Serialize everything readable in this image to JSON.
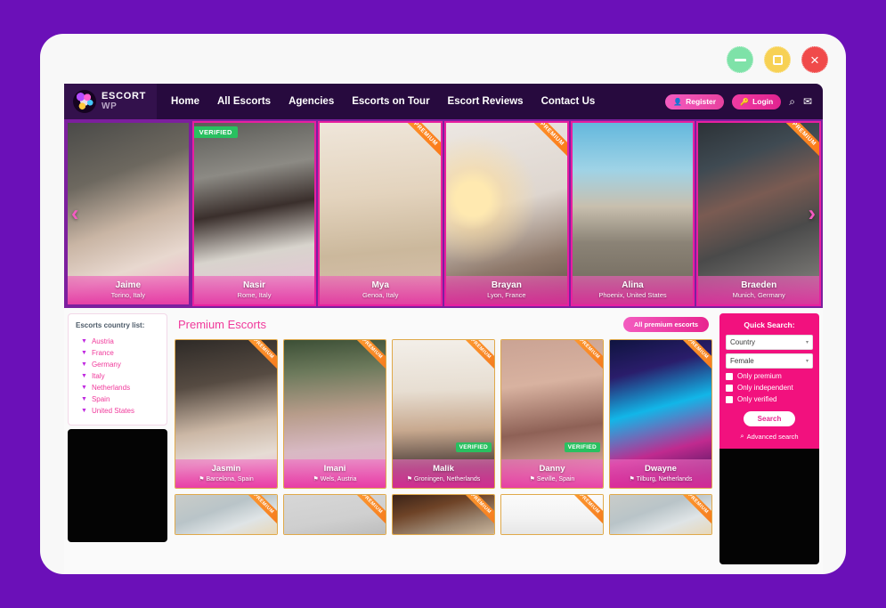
{
  "window": {
    "controls": [
      {
        "name": "minimize",
        "glyph": "minus"
      },
      {
        "name": "maximize",
        "glyph": "square"
      },
      {
        "name": "close",
        "glyph": "×"
      }
    ]
  },
  "navbar": {
    "logo": {
      "line1": "ESCORT",
      "line2": "WP"
    },
    "links": [
      "Home",
      "All Escorts",
      "Agencies",
      "Escorts on Tour",
      "Escort Reviews",
      "Contact Us"
    ],
    "register_label": "Register",
    "register_icon": "user-icon",
    "login_label": "Login",
    "login_icon": "key-icon",
    "search_icon": "⌕",
    "mail_icon": "✉"
  },
  "carousel": {
    "prev_icon": "‹",
    "next_icon": "›",
    "slides": [
      {
        "name": "Jaime",
        "location": "Torino, Italy",
        "badge": "",
        "ribbon": ""
      },
      {
        "name": "Nasir",
        "location": "Rome, Italy",
        "badge": "VERIFIED",
        "ribbon": ""
      },
      {
        "name": "Mya",
        "location": "Genoa, Italy",
        "badge": "",
        "ribbon": "PREMIUM"
      },
      {
        "name": "Brayan",
        "location": "Lyon, France",
        "badge": "",
        "ribbon": "PREMIUM"
      },
      {
        "name": "Alina",
        "location": "Phoenix, United States",
        "badge": "",
        "ribbon": ""
      },
      {
        "name": "Braeden",
        "location": "Munich, Germany",
        "badge": "",
        "ribbon": "PREMIUM"
      }
    ]
  },
  "left_sidebar": {
    "title": "Escorts country list:",
    "countries": [
      "Austria",
      "France",
      "Germany",
      "Italy",
      "Netherlands",
      "Spain",
      "United States"
    ]
  },
  "main": {
    "section_title": "Premium Escorts",
    "all_premium_label": "All premium escorts",
    "cards_row1": [
      {
        "name": "Jasmin",
        "location": "Barcelona, Spain",
        "ribbon": "PREMIUM",
        "verified": ""
      },
      {
        "name": "Imani",
        "location": "Wels, Austria",
        "ribbon": "PREMIUM",
        "verified": ""
      },
      {
        "name": "Malik",
        "location": "Groningen, Netherlands",
        "ribbon": "PREMIUM",
        "verified": "VERIFIED"
      },
      {
        "name": "Danny",
        "location": "Seville, Spain",
        "ribbon": "PREMIUM",
        "verified": "VERIFIED"
      },
      {
        "name": "Dwayne",
        "location": "Tilburg, Netherlands",
        "ribbon": "PREMIUM",
        "verified": ""
      }
    ],
    "cards_row2": [
      {
        "ribbon": "PREMIUM"
      },
      {
        "ribbon": "PREMIUM"
      },
      {
        "ribbon": "PREMIUM"
      },
      {
        "ribbon": "PREMIUM"
      },
      {
        "ribbon": "PREMIUM"
      }
    ],
    "pin_icon": "⚑"
  },
  "right_sidebar": {
    "title": "Quick Search:",
    "country_select": "Country",
    "gender_select": "Female",
    "caret_icon": "▾",
    "checkboxes": [
      "Only premium",
      "Only independent",
      "Only verified"
    ],
    "search_label": "Search",
    "advanced_label": "Advanced search",
    "advanced_icon": "⌕"
  },
  "colors": {
    "page_background": "#6B10B8",
    "navbar": "#270A3E",
    "accent_pink": "#F0399B",
    "accent_magenta": "#E8258F",
    "quick_search_bg": "#F2117E",
    "premium_orange": "#F4761B",
    "verified_green": "#29C060",
    "carousel_frame": "#7C1F9E"
  }
}
